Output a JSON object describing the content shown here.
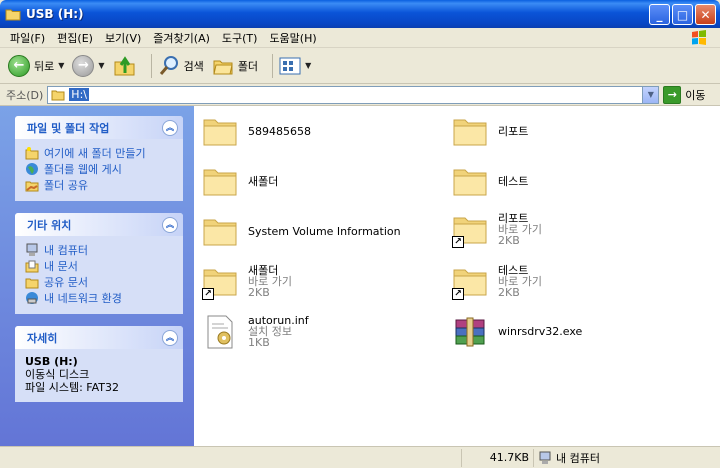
{
  "window": {
    "title": "USB (H:)"
  },
  "menu": [
    "파일(F)",
    "편집(E)",
    "보기(V)",
    "즐겨찾기(A)",
    "도구(T)",
    "도움말(H)"
  ],
  "toolbar": {
    "back_label": "뒤로",
    "search_label": "검색",
    "folders_label": "폴더"
  },
  "address": {
    "label": "주소(D)",
    "value": "H:\\",
    "go_label": "이동"
  },
  "tasks_panel": {
    "title": "파일 및 폴더 작업",
    "items": [
      "여기에 새 폴더 만들기",
      "폴더를 웹에 게시",
      "폴더 공유"
    ]
  },
  "places_panel": {
    "title": "기타 위치",
    "items": [
      "내 컴퓨터",
      "내 문서",
      "공유 문서",
      "내 네트워크 환경"
    ]
  },
  "details_panel": {
    "title": "자세히",
    "name": "USB (H:)",
    "type": "이동식 디스크",
    "fs": "파일 시스템: FAT32"
  },
  "files": [
    {
      "name": "589485658",
      "sub1": "",
      "sub2": ""
    },
    {
      "name": "리포트",
      "sub1": "",
      "sub2": ""
    },
    {
      "name": "새폴더",
      "sub1": "",
      "sub2": ""
    },
    {
      "name": "테스트",
      "sub1": "",
      "sub2": ""
    },
    {
      "name": "System Volume Information",
      "sub1": "",
      "sub2": ""
    },
    {
      "name": "리포트",
      "sub1": "바로 가기",
      "sub2": "2KB"
    },
    {
      "name": "새폴더",
      "sub1": "바로 가기",
      "sub2": "2KB"
    },
    {
      "name": "테스트",
      "sub1": "바로 가기",
      "sub2": "2KB"
    },
    {
      "name": "autorun.inf",
      "sub1": "설치 정보",
      "sub2": "1KB"
    },
    {
      "name": "winrsdrv32.exe",
      "sub1": "",
      "sub2": ""
    }
  ],
  "status": {
    "size": "41.7KB",
    "location": "내 컴퓨터"
  }
}
